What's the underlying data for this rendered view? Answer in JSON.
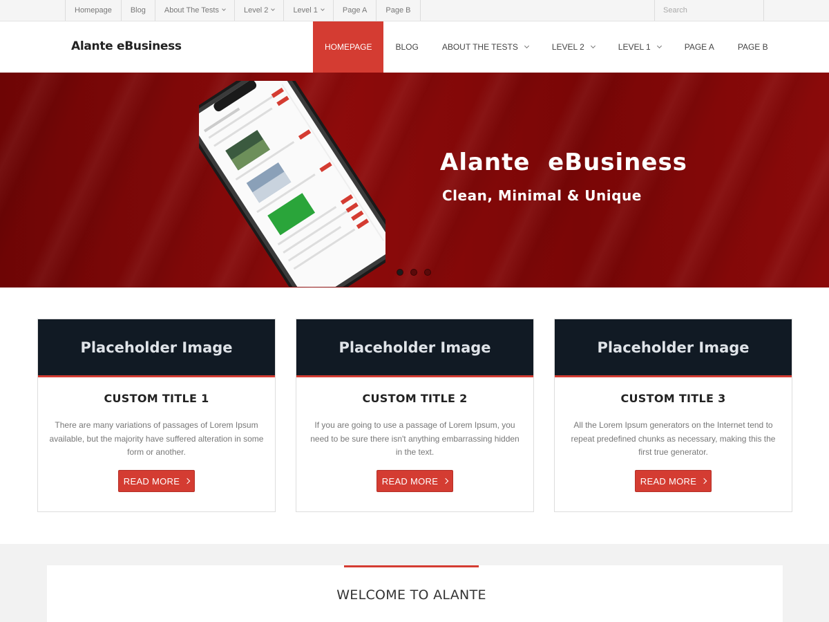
{
  "topbar": {
    "items": [
      {
        "label": "Homepage",
        "dropdown": false
      },
      {
        "label": "Blog",
        "dropdown": false
      },
      {
        "label": "About The Tests",
        "dropdown": true
      },
      {
        "label": "Level 2",
        "dropdown": true
      },
      {
        "label": "Level 1",
        "dropdown": true
      },
      {
        "label": "Page A",
        "dropdown": false
      },
      {
        "label": "Page B",
        "dropdown": false
      }
    ],
    "search_placeholder": "Search"
  },
  "header": {
    "logo": "Alante eBusiness",
    "nav": [
      {
        "label": "Homepage",
        "active": true,
        "dropdown": false
      },
      {
        "label": "Blog",
        "active": false,
        "dropdown": false
      },
      {
        "label": "About The Tests",
        "active": false,
        "dropdown": true
      },
      {
        "label": "Level 2",
        "active": false,
        "dropdown": true
      },
      {
        "label": "Level 1",
        "active": false,
        "dropdown": true
      },
      {
        "label": "Page A",
        "active": false,
        "dropdown": false
      },
      {
        "label": "Page B",
        "active": false,
        "dropdown": false
      }
    ]
  },
  "hero": {
    "title": "Alante  eBusiness",
    "subtitle": "Clean, Minimal & Unique",
    "slides": 3,
    "active_slide": 1
  },
  "cards": [
    {
      "image_label": "Placeholder Image",
      "title": "CUSTOM TITLE 1",
      "text": "There are many variations of passages of Lorem Ipsum available, but the majority have suffered alteration in some form or another.",
      "button": "READ MORE"
    },
    {
      "image_label": "Placeholder Image",
      "title": "CUSTOM TITLE 2",
      "text": "If you are going to use a passage of Lorem Ipsum, you need to be sure there isn't anything embarrassing hidden in the text.",
      "button": "READ MORE"
    },
    {
      "image_label": "Placeholder Image",
      "title": "CUSTOM TITLE 3",
      "text": "All the Lorem Ipsum generators on the Internet tend to repeat predefined chunks as necessary, making this the first true generator.",
      "button": "READ MORE"
    }
  ],
  "welcome": {
    "title": "WELCOME TO ALANTE"
  },
  "colors": {
    "accent": "#d43c32",
    "hero_red": "#8e0b0b",
    "placeholder_bg": "#111a24"
  }
}
